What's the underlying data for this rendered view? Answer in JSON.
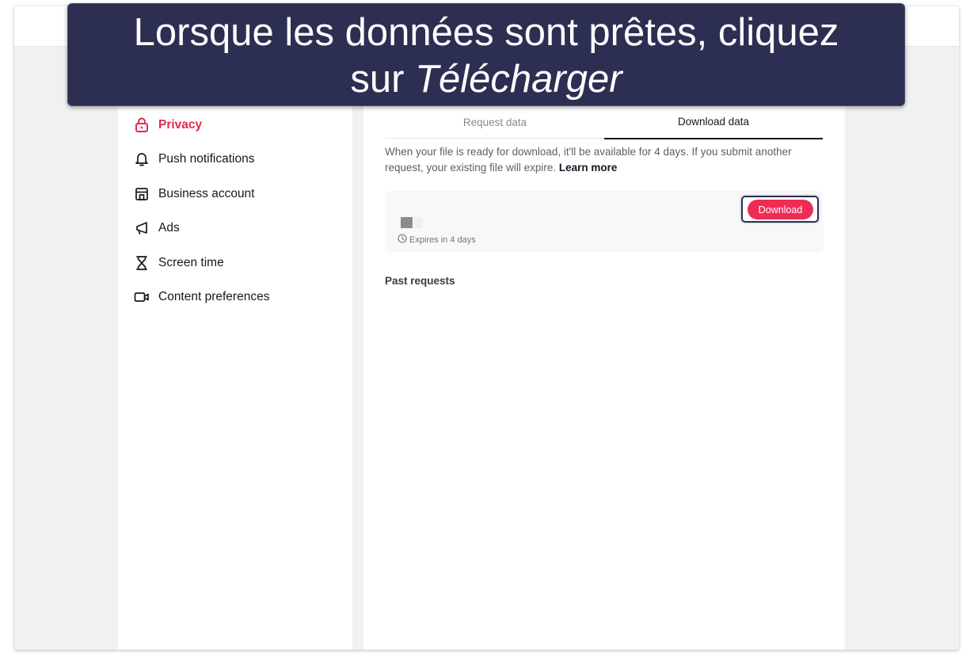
{
  "banner": {
    "line1": "Lorsque les données sont prêtes, cliquez",
    "line2_prefix": "sur ",
    "line2_emphasis": "Télécharger"
  },
  "sidebar": {
    "items": [
      {
        "label": "Privacy",
        "icon": "lock-icon",
        "active": true
      },
      {
        "label": "Push notifications",
        "icon": "bell-icon",
        "active": false
      },
      {
        "label": "Business account",
        "icon": "storefront-icon",
        "active": false
      },
      {
        "label": "Ads",
        "icon": "megaphone-icon",
        "active": false
      },
      {
        "label": "Screen time",
        "icon": "hourglass-icon",
        "active": false
      },
      {
        "label": "Content preferences",
        "icon": "video-camera-icon",
        "active": false
      }
    ]
  },
  "main": {
    "tabs": [
      {
        "label": "Request data",
        "active": false
      },
      {
        "label": "Download data",
        "active": true
      }
    ],
    "info_text": "When your file is ready for download, it'll be available for 4 days. If you submit another request, your existing file will expire.",
    "learn_more": "Learn more",
    "file": {
      "expires": "Expires in 4 days",
      "download_label": "Download"
    },
    "past_requests": "Past requests"
  },
  "colors": {
    "accent": "#ee2c55",
    "active_nav": "#e4284e",
    "banner_bg": "#2c2f51",
    "text": "#161823"
  }
}
